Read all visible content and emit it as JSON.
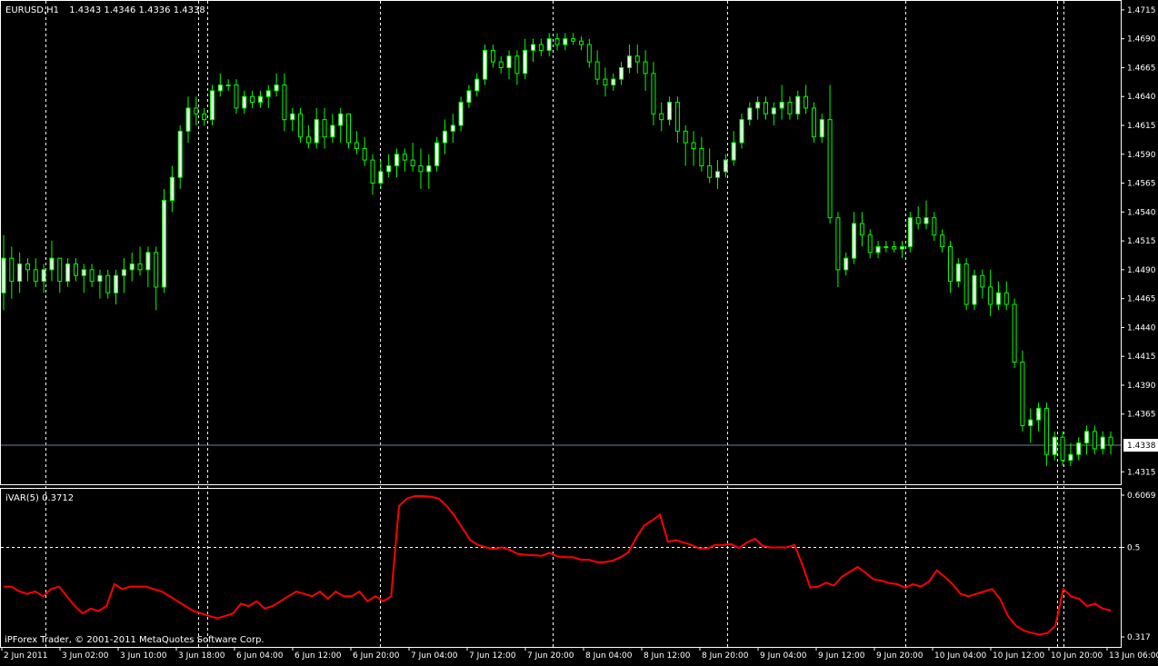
{
  "main_panel": {
    "symbol_label": "EURUSD,H1",
    "ohlc_label": "1.4343 1.4346 1.4336 1.4338",
    "current_price_label": "1.4338",
    "y_tick_labels": [
      "1.4715",
      "1.4690",
      "1.4665",
      "1.4640",
      "1.4615",
      "1.4590",
      "1.4565",
      "1.4540",
      "1.4515",
      "1.4490",
      "1.4465",
      "1.4440",
      "1.4415",
      "1.4390",
      "1.4365",
      "1.4315"
    ]
  },
  "indicator_panel": {
    "label": "iVAR(5) 0.3712",
    "y_tick_labels": [
      "0.6069",
      "0.5",
      "0.317"
    ],
    "copyright": "iPForex Trader, © 2001-2011 MetaQuotes Software Corp."
  },
  "x_tick_labels": [
    "2 Jun 2011",
    "3 Jun 02:00",
    "3 Jun 10:00",
    "3 Jun 18:00",
    "6 Jun 04:00",
    "6 Jun 12:00",
    "6 Jun 20:00",
    "7 Jun 04:00",
    "7 Jun 12:00",
    "7 Jun 20:00",
    "8 Jun 04:00",
    "8 Jun 12:00",
    "8 Jun 20:00",
    "9 Jun 04:00",
    "9 Jun 12:00",
    "9 Jun 20:00",
    "10 Jun 04:00",
    "10 Jun 12:00",
    "10 Jun 20:00",
    "13 Jun 06:00"
  ],
  "colors": {
    "background": "#000000",
    "frame": "#ffffff",
    "grid": "#ffffff",
    "bull_candle": "#ffffff",
    "wick": "#00ff00",
    "bear_candle": "#000000",
    "indicator_line": "#ff0000",
    "price_line": "#708090"
  },
  "chart_data": [
    {
      "type": "candlestick",
      "symbol": "EURUSD",
      "timeframe": "H1",
      "ylim": [
        1.4305,
        1.4722
      ],
      "current_price": 1.4338,
      "grid": "vertical dashed day separators",
      "candles": [
        [
          1.447,
          1.452,
          1.4455,
          1.45
        ],
        [
          1.45,
          1.451,
          1.4465,
          1.448
        ],
        [
          1.448,
          1.4505,
          1.447,
          1.4495
        ],
        [
          1.4495,
          1.45,
          1.448,
          1.449
        ],
        [
          1.449,
          1.45,
          1.4475,
          1.448
        ],
        [
          1.448,
          1.4495,
          1.447,
          1.449
        ],
        [
          1.449,
          1.4515,
          1.448,
          1.45
        ],
        [
          1.45,
          1.45,
          1.447,
          1.448
        ],
        [
          1.448,
          1.45,
          1.4475,
          1.4495
        ],
        [
          1.4495,
          1.45,
          1.448,
          1.4485
        ],
        [
          1.4485,
          1.4495,
          1.447,
          1.449
        ],
        [
          1.449,
          1.4495,
          1.4475,
          1.448
        ],
        [
          1.448,
          1.449,
          1.4465,
          1.4485
        ],
        [
          1.4485,
          1.449,
          1.4465,
          1.447
        ],
        [
          1.447,
          1.449,
          1.446,
          1.4485
        ],
        [
          1.4485,
          1.45,
          1.447,
          1.449
        ],
        [
          1.449,
          1.4505,
          1.448,
          1.4495
        ],
        [
          1.4495,
          1.451,
          1.4485,
          1.449
        ],
        [
          1.449,
          1.451,
          1.4475,
          1.4505
        ],
        [
          1.4505,
          1.451,
          1.4455,
          1.4475
        ],
        [
          1.4475,
          1.456,
          1.447,
          1.455
        ],
        [
          1.455,
          1.458,
          1.454,
          1.457
        ],
        [
          1.457,
          1.4615,
          1.456,
          1.461
        ],
        [
          1.461,
          1.464,
          1.46,
          1.463
        ],
        [
          1.463,
          1.464,
          1.4615,
          1.4625
        ],
        [
          1.4625,
          1.463,
          1.4615,
          1.462
        ],
        [
          1.462,
          1.465,
          1.4615,
          1.4645
        ],
        [
          1.4645,
          1.466,
          1.464,
          1.465
        ],
        [
          1.465,
          1.4655,
          1.4645,
          1.465
        ],
        [
          1.465,
          1.4655,
          1.4625,
          1.463
        ],
        [
          1.463,
          1.4645,
          1.4625,
          1.464
        ],
        [
          1.464,
          1.4645,
          1.463,
          1.4635
        ],
        [
          1.4635,
          1.4645,
          1.463,
          1.464
        ],
        [
          1.464,
          1.465,
          1.463,
          1.4645
        ],
        [
          1.4645,
          1.466,
          1.464,
          1.465
        ],
        [
          1.465,
          1.466,
          1.461,
          1.462
        ],
        [
          1.462,
          1.463,
          1.461,
          1.4625
        ],
        [
          1.4625,
          1.463,
          1.46,
          1.4605
        ],
        [
          1.4605,
          1.4615,
          1.4595,
          1.46
        ],
        [
          1.46,
          1.463,
          1.4595,
          1.462
        ],
        [
          1.462,
          1.463,
          1.4595,
          1.4605
        ],
        [
          1.4605,
          1.4625,
          1.46,
          1.4615
        ],
        [
          1.4615,
          1.463,
          1.46,
          1.4625
        ],
        [
          1.4625,
          1.4625,
          1.4595,
          1.46
        ],
        [
          1.46,
          1.461,
          1.459,
          1.4595
        ],
        [
          1.4595,
          1.4605,
          1.458,
          1.4585
        ],
        [
          1.4585,
          1.459,
          1.4555,
          1.4565
        ],
        [
          1.4565,
          1.4585,
          1.456,
          1.4575
        ],
        [
          1.4575,
          1.459,
          1.457,
          1.458
        ],
        [
          1.458,
          1.4595,
          1.457,
          1.459
        ],
        [
          1.459,
          1.4595,
          1.4575,
          1.4585
        ],
        [
          1.4585,
          1.46,
          1.4575,
          1.458
        ],
        [
          1.458,
          1.4595,
          1.456,
          1.4575
        ],
        [
          1.4575,
          1.459,
          1.456,
          1.458
        ],
        [
          1.458,
          1.4605,
          1.4575,
          1.46
        ],
        [
          1.46,
          1.462,
          1.459,
          1.461
        ],
        [
          1.461,
          1.4625,
          1.46,
          1.4615
        ],
        [
          1.4615,
          1.464,
          1.461,
          1.4635
        ],
        [
          1.4635,
          1.465,
          1.463,
          1.4645
        ],
        [
          1.4645,
          1.466,
          1.464,
          1.4655
        ],
        [
          1.4655,
          1.4685,
          1.465,
          1.468
        ],
        [
          1.468,
          1.4685,
          1.4665,
          1.467
        ],
        [
          1.467,
          1.4675,
          1.466,
          1.4665
        ],
        [
          1.4665,
          1.468,
          1.4655,
          1.4675
        ],
        [
          1.4675,
          1.468,
          1.465,
          1.466
        ],
        [
          1.466,
          1.469,
          1.4655,
          1.468
        ],
        [
          1.468,
          1.469,
          1.467,
          1.4685
        ],
        [
          1.4685,
          1.469,
          1.4675,
          1.468
        ],
        [
          1.468,
          1.4695,
          1.4675,
          1.469
        ],
        [
          1.469,
          1.4695,
          1.468,
          1.4685
        ],
        [
          1.4685,
          1.4695,
          1.468,
          1.469
        ],
        [
          1.469,
          1.4695,
          1.4685,
          1.4688
        ],
        [
          1.4688,
          1.4692,
          1.468,
          1.4685
        ],
        [
          1.4685,
          1.469,
          1.4665,
          1.467
        ],
        [
          1.467,
          1.468,
          1.465,
          1.4655
        ],
        [
          1.4655,
          1.4665,
          1.464,
          1.465
        ],
        [
          1.465,
          1.466,
          1.4645,
          1.4655
        ],
        [
          1.4655,
          1.467,
          1.465,
          1.4665
        ],
        [
          1.4665,
          1.4685,
          1.466,
          1.4675
        ],
        [
          1.4675,
          1.4685,
          1.466,
          1.467
        ],
        [
          1.467,
          1.468,
          1.4645,
          1.466
        ],
        [
          1.466,
          1.467,
          1.4615,
          1.4625
        ],
        [
          1.4625,
          1.4635,
          1.461,
          1.462
        ],
        [
          1.462,
          1.464,
          1.4615,
          1.4635
        ],
        [
          1.4635,
          1.464,
          1.46,
          1.461
        ],
        [
          1.461,
          1.4615,
          1.458,
          1.46
        ],
        [
          1.46,
          1.461,
          1.458,
          1.4595
        ],
        [
          1.4595,
          1.4605,
          1.4575,
          1.458
        ],
        [
          1.458,
          1.4595,
          1.4565,
          1.457
        ],
        [
          1.457,
          1.4585,
          1.456,
          1.4575
        ],
        [
          1.4575,
          1.459,
          1.457,
          1.4585
        ],
        [
          1.4585,
          1.461,
          1.458,
          1.46
        ],
        [
          1.46,
          1.4625,
          1.4595,
          1.462
        ],
        [
          1.462,
          1.4635,
          1.4615,
          1.463
        ],
        [
          1.463,
          1.464,
          1.462,
          1.4635
        ],
        [
          1.4635,
          1.464,
          1.462,
          1.4625
        ],
        [
          1.4625,
          1.4635,
          1.4615,
          1.463
        ],
        [
          1.463,
          1.465,
          1.462,
          1.4635
        ],
        [
          1.4635,
          1.464,
          1.462,
          1.4625
        ],
        [
          1.4625,
          1.4645,
          1.462,
          1.464
        ],
        [
          1.464,
          1.465,
          1.4625,
          1.463
        ],
        [
          1.463,
          1.4635,
          1.46,
          1.4605
        ],
        [
          1.4605,
          1.4625,
          1.46,
          1.462
        ],
        [
          1.462,
          1.465,
          1.453,
          1.4535
        ],
        [
          1.4535,
          1.454,
          1.4475,
          1.449
        ],
        [
          1.449,
          1.4505,
          1.4485,
          1.45
        ],
        [
          1.45,
          1.454,
          1.4495,
          1.453
        ],
        [
          1.453,
          1.454,
          1.451,
          1.452
        ],
        [
          1.452,
          1.4525,
          1.45,
          1.4505
        ],
        [
          1.4505,
          1.4515,
          1.45,
          1.451
        ],
        [
          1.451,
          1.4515,
          1.4505,
          1.451
        ],
        [
          1.451,
          1.4515,
          1.4505,
          1.4508
        ],
        [
          1.4508,
          1.4515,
          1.45,
          1.451
        ],
        [
          1.451,
          1.454,
          1.4505,
          1.4535
        ],
        [
          1.4535,
          1.4545,
          1.4525,
          1.453
        ],
        [
          1.453,
          1.455,
          1.4525,
          1.4535
        ],
        [
          1.4535,
          1.454,
          1.4515,
          1.452
        ],
        [
          1.452,
          1.4525,
          1.4505,
          1.451
        ],
        [
          1.451,
          1.4515,
          1.447,
          1.448
        ],
        [
          1.448,
          1.45,
          1.4475,
          1.4495
        ],
        [
          1.4495,
          1.45,
          1.4455,
          1.446
        ],
        [
          1.446,
          1.449,
          1.4455,
          1.4485
        ],
        [
          1.4485,
          1.449,
          1.4465,
          1.4475
        ],
        [
          1.4475,
          1.449,
          1.445,
          1.446
        ],
        [
          1.446,
          1.448,
          1.4455,
          1.447
        ],
        [
          1.447,
          1.448,
          1.4455,
          1.446
        ],
        [
          1.446,
          1.4465,
          1.4405,
          1.441
        ],
        [
          1.441,
          1.442,
          1.435,
          1.4355
        ],
        [
          1.4355,
          1.437,
          1.434,
          1.436
        ],
        [
          1.436,
          1.4375,
          1.435,
          1.437
        ],
        [
          1.437,
          1.4375,
          1.432,
          1.433
        ],
        [
          1.433,
          1.435,
          1.4325,
          1.4345
        ],
        [
          1.4345,
          1.435,
          1.432,
          1.4325
        ],
        [
          1.4325,
          1.434,
          1.432,
          1.433
        ],
        [
          1.433,
          1.4345,
          1.4325,
          1.434
        ],
        [
          1.434,
          1.4355,
          1.433,
          1.435
        ],
        [
          1.435,
          1.4355,
          1.433,
          1.4335
        ],
        [
          1.4335,
          1.435,
          1.433,
          1.4345
        ],
        [
          1.4345,
          1.435,
          1.433,
          1.4338
        ]
      ]
    },
    {
      "type": "line",
      "name": "iVAR(5)",
      "last_value": 0.3712,
      "ylim": [
        0.317,
        0.6069
      ],
      "reference_line": 0.5,
      "values": [
        0.42,
        0.42,
        0.41,
        0.405,
        0.41,
        0.4,
        0.415,
        0.42,
        0.4,
        0.38,
        0.365,
        0.375,
        0.37,
        0.38,
        0.425,
        0.415,
        0.42,
        0.42,
        0.42,
        0.415,
        0.41,
        0.4,
        0.39,
        0.38,
        0.37,
        0.365,
        0.36,
        0.355,
        0.36,
        0.365,
        0.385,
        0.38,
        0.39,
        0.375,
        0.38,
        0.39,
        0.4,
        0.41,
        0.405,
        0.4,
        0.41,
        0.395,
        0.41,
        0.4,
        0.4,
        0.41,
        0.39,
        0.4,
        0.39,
        0.4,
        0.585,
        0.6,
        0.605,
        0.605,
        0.604,
        0.6,
        0.585,
        0.565,
        0.54,
        0.515,
        0.505,
        0.5,
        0.497,
        0.5,
        0.495,
        0.487,
        0.485,
        0.484,
        0.483,
        0.489,
        0.482,
        0.48,
        0.48,
        0.475,
        0.475,
        0.47,
        0.47,
        0.473,
        0.48,
        0.49,
        0.52,
        0.545,
        0.555,
        0.567,
        0.512,
        0.515,
        0.51,
        0.505,
        0.498,
        0.498,
        0.505,
        0.505,
        0.507,
        0.499,
        0.51,
        0.518,
        0.503,
        0.5,
        0.5,
        0.5,
        0.505,
        0.465,
        0.418,
        0.42,
        0.428,
        0.422,
        0.44,
        0.45,
        0.46,
        0.448,
        0.435,
        0.432,
        0.427,
        0.425,
        0.418,
        0.425,
        0.42,
        0.43,
        0.453,
        0.44,
        0.425,
        0.405,
        0.4,
        0.405,
        0.41,
        0.415,
        0.395,
        0.36,
        0.34,
        0.33,
        0.325,
        0.322,
        0.325,
        0.34,
        0.415,
        0.4,
        0.395,
        0.38,
        0.385,
        0.375,
        0.371
      ]
    }
  ]
}
